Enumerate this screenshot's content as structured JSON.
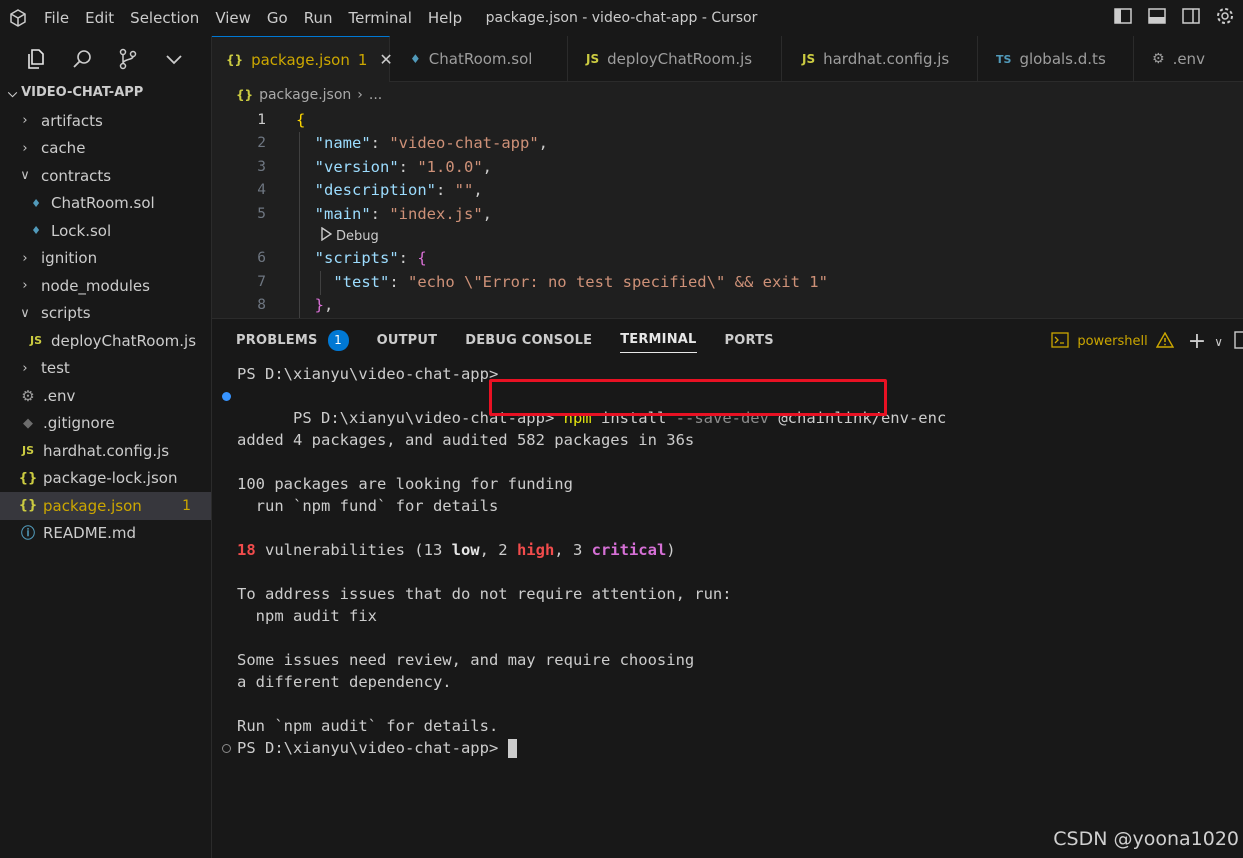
{
  "titlebar": {
    "menu": [
      "File",
      "Edit",
      "Selection",
      "View",
      "Go",
      "Run",
      "Terminal",
      "Help"
    ],
    "window_title": "package.json - video-chat-app - Cursor"
  },
  "explorer": {
    "root": "VIDEO-CHAT-APP",
    "items": [
      {
        "label": "artifacts",
        "type": "folder",
        "depth": 0,
        "expanded": false
      },
      {
        "label": "cache",
        "type": "folder",
        "depth": 0,
        "expanded": false
      },
      {
        "label": "contracts",
        "type": "folder",
        "depth": 0,
        "expanded": true
      },
      {
        "label": "ChatRoom.sol",
        "type": "sol",
        "depth": 1
      },
      {
        "label": "Lock.sol",
        "type": "sol",
        "depth": 1
      },
      {
        "label": "ignition",
        "type": "folder",
        "depth": 0,
        "expanded": false
      },
      {
        "label": "node_modules",
        "type": "folder",
        "depth": 0,
        "expanded": false
      },
      {
        "label": "scripts",
        "type": "folder",
        "depth": 0,
        "expanded": true
      },
      {
        "label": "deployChatRoom.js",
        "type": "js",
        "depth": 1
      },
      {
        "label": "test",
        "type": "folder",
        "depth": 0,
        "expanded": false
      },
      {
        "label": ".env",
        "type": "env",
        "depth": 0
      },
      {
        "label": ".gitignore",
        "type": "git",
        "depth": 0
      },
      {
        "label": "hardhat.config.js",
        "type": "js",
        "depth": 0
      },
      {
        "label": "package-lock.json",
        "type": "json",
        "depth": 0
      },
      {
        "label": "package.json",
        "type": "json",
        "depth": 0,
        "active": true,
        "badge": "1"
      },
      {
        "label": "README.md",
        "type": "info",
        "depth": 0
      }
    ]
  },
  "tabs": [
    {
      "label": "package.json",
      "icon": "{}",
      "badge": "1",
      "active": true
    },
    {
      "label": "ChatRoom.sol",
      "icon": "sol"
    },
    {
      "label": "deployChatRoom.js",
      "icon": "JS"
    },
    {
      "label": "hardhat.config.js",
      "icon": "JS"
    },
    {
      "label": "globals.d.ts",
      "icon": "TS"
    },
    {
      "label": ".env",
      "icon": "gear"
    }
  ],
  "editor": {
    "breadcrumb": [
      "package.json",
      "..."
    ],
    "codelens": "Debug",
    "lines": {
      "n1": "1",
      "n2": "2",
      "n3": "3",
      "n4": "4",
      "n5": "5",
      "n6": "6",
      "n7": "7",
      "n8": "8"
    }
  },
  "panel": {
    "tabs": [
      "PROBLEMS",
      "OUTPUT",
      "DEBUG CONSOLE",
      "TERMINAL",
      "PORTS"
    ],
    "problems_count": "1",
    "shell": "powershell",
    "prompt": "PS D:\\xianyu\\video-chat-app>",
    "command_npm": "npm",
    "command_install": "install",
    "command_flag": "--save-dev",
    "command_pkg": "@chainlink/env-enc",
    "out_added": "added 4 packages, and audited 582 packages in 36s",
    "out_funding1": "100 packages are looking for funding",
    "out_funding2": "  run `npm fund` for details",
    "vuln_count": "18",
    "vuln_text1": " vulnerabilities (13 ",
    "vuln_low": "low",
    "vuln_text2": ", 2 ",
    "vuln_high": "high",
    "vuln_text3": ", 3 ",
    "vuln_critical": "critical",
    "vuln_text4": ")",
    "out_address1": "To address issues that do not require attention, run:",
    "out_address2": "  npm audit fix",
    "out_review1": "Some issues need review, and may require choosing",
    "out_review2": "a different dependency.",
    "out_run": "Run `npm audit` for details."
  },
  "watermark": "CSDN @yoona1020",
  "colors": {
    "accent": "#0078d4",
    "warning": "#cca700",
    "highlight_box": "#e81123"
  }
}
